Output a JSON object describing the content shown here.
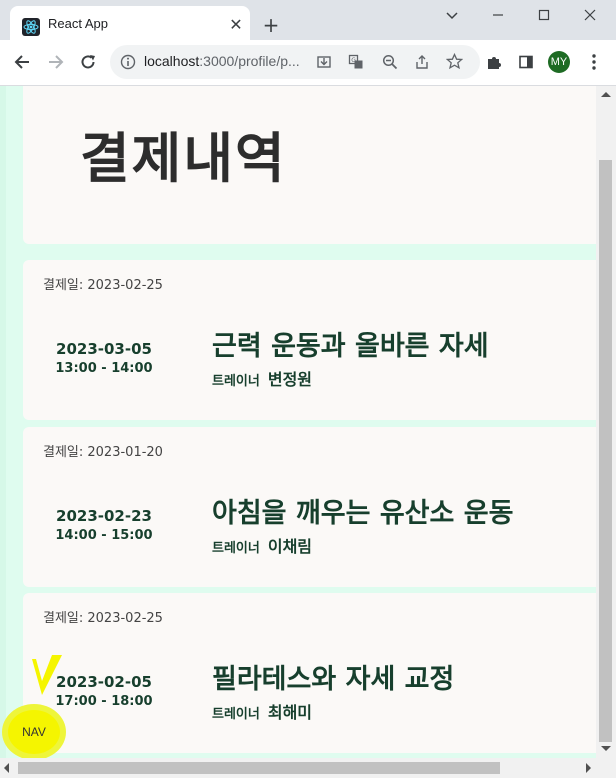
{
  "browser": {
    "tab_title": "React App",
    "url_host": "localhost",
    "url_rest": ":3000/profile/p...",
    "profile_initials": "MY"
  },
  "page": {
    "title": "결제내역",
    "trainer_label": "트레이너",
    "payments": [
      {
        "paid_on": "결제일: 2023-02-25",
        "session_date": "2023-03-05",
        "session_time": "13:00 - 14:00",
        "class_name": "근력 운동과 올바른 자세",
        "trainer": "변정원"
      },
      {
        "paid_on": "결제일: 2023-01-20",
        "session_date": "2023-02-23",
        "session_time": "14:00 - 15:00",
        "class_name": "아침을 깨우는 유산소 운동",
        "trainer": "이채림"
      },
      {
        "paid_on": "결제일: 2023-02-25",
        "session_date": "2023-02-05",
        "session_time": "17:00 - 18:00",
        "class_name": "필라테스와 자세 교정",
        "trainer": "최해미"
      }
    ]
  },
  "nav_button": "NAV",
  "colors": {
    "page_bg": "#dffcef",
    "card_bg": "#fbf9f7",
    "text_dark_green": "#173f2d",
    "nav_yellow": "#f5f500"
  }
}
